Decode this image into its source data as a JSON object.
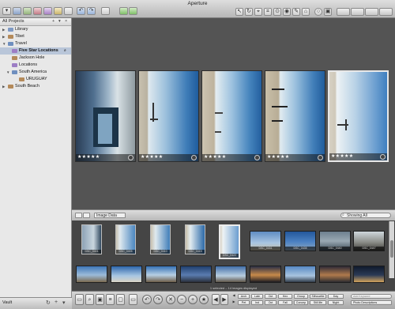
{
  "window": {
    "title": "Aperture"
  },
  "sidebar": {
    "header": "All Projects",
    "items": [
      {
        "label": "Library",
        "level": 0
      },
      {
        "label": "Tibet",
        "level": 0
      },
      {
        "label": "Travel",
        "level": 0
      },
      {
        "label": "Five Star Locations",
        "level": 1,
        "selected": true
      },
      {
        "label": "Jackson Hole",
        "level": 1
      },
      {
        "label": "Locations",
        "level": 1
      },
      {
        "label": "South America",
        "level": 1
      },
      {
        "label": "URUGUAY",
        "level": 2
      },
      {
        "label": "South Beach",
        "level": 0
      }
    ]
  },
  "viewer": {
    "images": [
      {
        "stars": "★★★★★",
        "selected": false
      },
      {
        "stars": "★★★★★",
        "selected": false
      },
      {
        "stars": "★★★★★",
        "selected": false
      },
      {
        "stars": "★★★★★",
        "selected": false
      },
      {
        "stars": "★★★★★",
        "selected": true
      }
    ]
  },
  "browser": {
    "view_mode": "Image Data",
    "search_placeholder": "Showing All",
    "status": "1 selected – 14 images displayed",
    "row1": [
      "DSC_0401",
      "DSC_0405",
      "DSC_0410",
      "DSC_0415",
      "DSC_0422",
      "DSC_0431",
      "DSC_0435",
      "DSC_0440",
      "DSC_0447"
    ],
    "row2": [
      "",
      "",
      "",
      "",
      "",
      "",
      "",
      "",
      ""
    ]
  },
  "keywords": {
    "row1": [
      "Arch",
      "Late",
      "Oct",
      "Hex",
      "Group",
      "Silhouette",
      "Day"
    ],
    "row2": [
      "Pet",
      "Ind",
      "Oct",
      "Fall",
      "Concep",
      "Still life",
      "Night"
    ],
    "field_placeholder": "Add Keyword",
    "preset_label": "Photo Descriptions"
  },
  "sidebar_footer": {
    "label": "Vault"
  },
  "colors": {
    "accent_select": "#b9c6d9",
    "folder_blue": "#6f8fbf"
  }
}
